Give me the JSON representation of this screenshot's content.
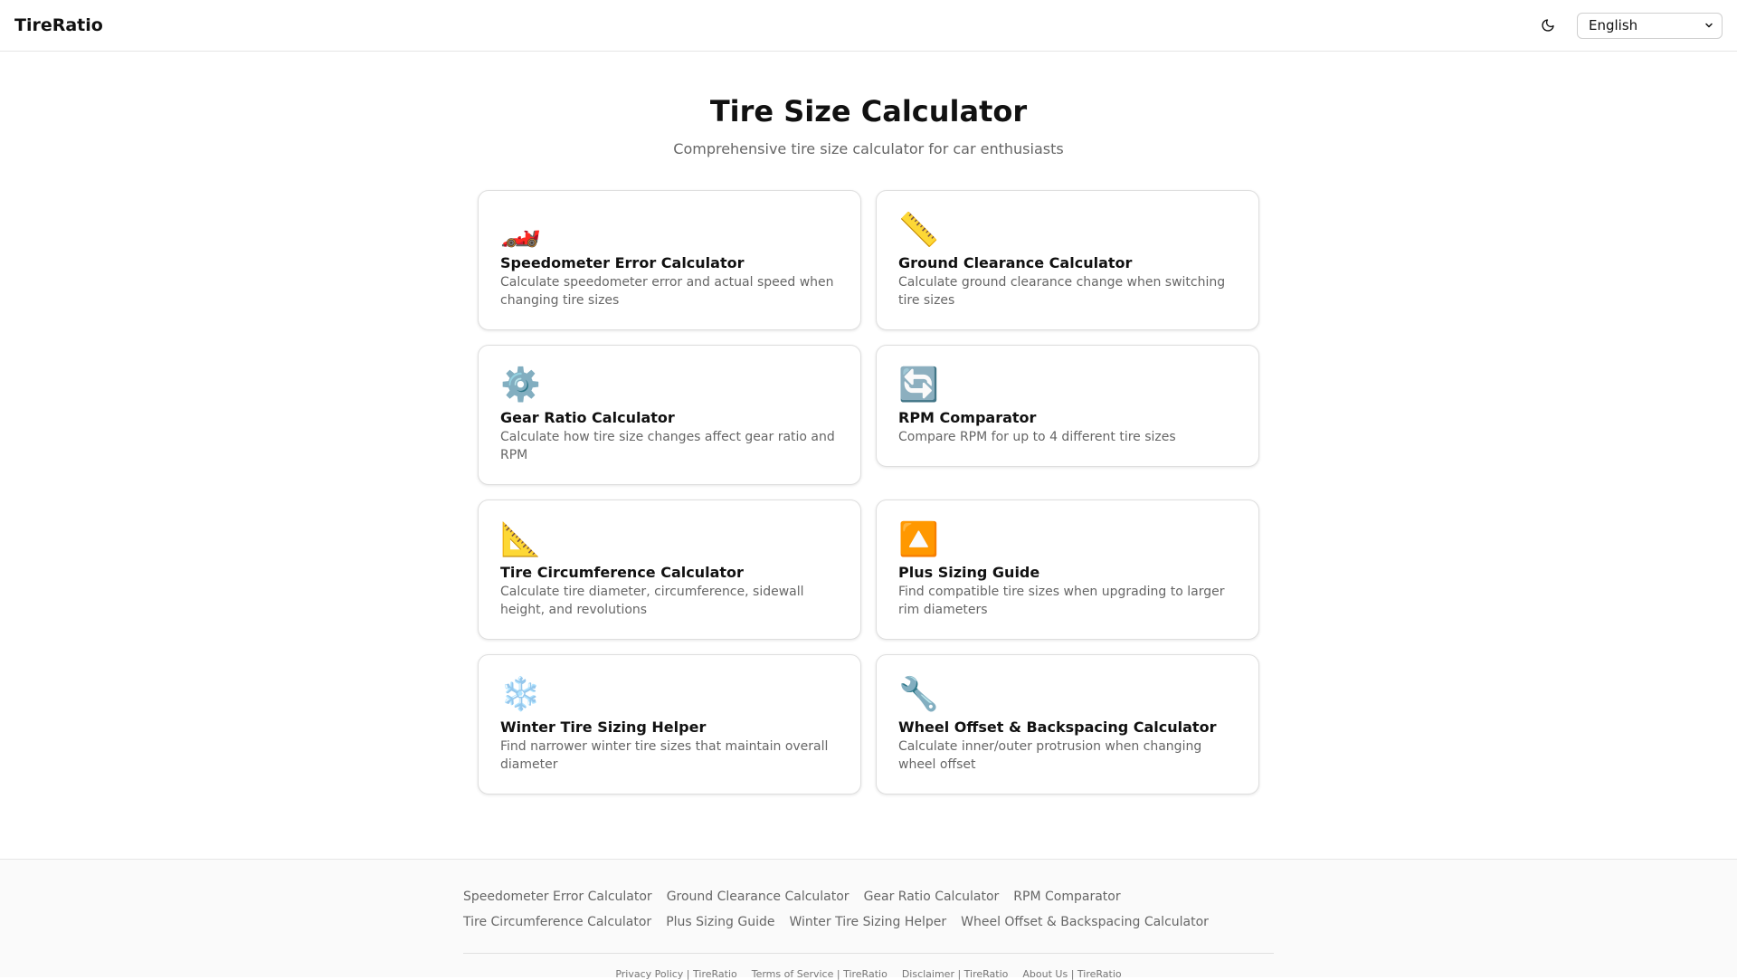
{
  "header": {
    "brand": "TireRatio",
    "theme_icon": "moon-icon",
    "language": "English"
  },
  "main": {
    "title": "Tire Size Calculator",
    "subtitle": "Comprehensive tire size calculator for car enthusiasts",
    "cards": [
      {
        "icon": "🏎️",
        "icon_name": "race-car-icon",
        "title": "Speedometer Error Calculator",
        "desc": "Calculate speedometer error and actual speed when changing tire sizes"
      },
      {
        "icon": "📏",
        "icon_name": "ruler-icon",
        "title": "Ground Clearance Calculator",
        "desc": "Calculate ground clearance change when switching tire sizes"
      },
      {
        "icon": "⚙️",
        "icon_name": "gear-icon",
        "title": "Gear Ratio Calculator",
        "desc": "Calculate how tire size changes affect gear ratio and RPM"
      },
      {
        "icon": "🔄",
        "icon_name": "refresh-arrows-icon",
        "title": "RPM Comparator",
        "desc": "Compare RPM for up to 4 different tire sizes"
      },
      {
        "icon": "📐",
        "icon_name": "triangle-ruler-icon",
        "title": "Tire Circumference Calculator",
        "desc": "Calculate tire diameter, circumference, sidewall height, and revolutions"
      },
      {
        "icon": "🔼",
        "icon_name": "up-arrow-icon",
        "title": "Plus Sizing Guide",
        "desc": "Find compatible tire sizes when upgrading to larger rim diameters"
      },
      {
        "icon": "❄️",
        "icon_name": "snowflake-icon",
        "title": "Winter Tire Sizing Helper",
        "desc": "Find narrower winter tire sizes that maintain overall diameter"
      },
      {
        "icon": "🔧",
        "icon_name": "wrench-icon",
        "title": "Wheel Offset & Backspacing Calculator",
        "desc": "Calculate inner/outer protrusion when changing wheel offset"
      }
    ]
  },
  "footer": {
    "links_row1": [
      "Speedometer Error Calculator",
      "Ground Clearance Calculator",
      "Gear Ratio Calculator",
      "RPM Comparator"
    ],
    "links_row2": [
      "Tire Circumference Calculator",
      "Plus Sizing Guide",
      "Winter Tire Sizing Helper",
      "Wheel Offset & Backspacing Calculator"
    ],
    "legal": [
      "Privacy Policy | TireRatio",
      "Terms of Service | TireRatio",
      "Disclaimer | TireRatio",
      "About Us | TireRatio"
    ]
  }
}
